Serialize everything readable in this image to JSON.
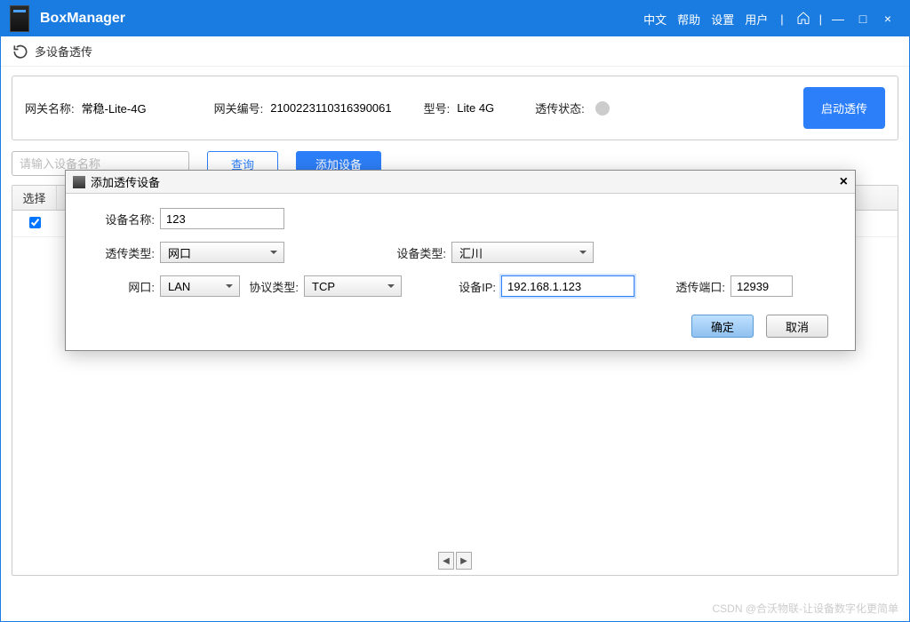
{
  "app": {
    "title": "BoxManager"
  },
  "titlebar": {
    "links": {
      "lang": "中文",
      "help": "帮助",
      "settings": "设置",
      "user": "用户"
    }
  },
  "subheader": {
    "title": "多设备透传"
  },
  "info": {
    "gw_name_lbl": "网关名称:",
    "gw_name_val": "常稳-Lite-4G",
    "gw_sn_lbl": "网关编号:",
    "gw_sn_val": "2100223110316390061",
    "model_lbl": "型号:",
    "model_val": "Lite 4G",
    "status_lbl": "透传状态:",
    "start_btn": "启动透传"
  },
  "toolbar": {
    "search_ph": "请输入设备名称",
    "query": "查询",
    "add": "添加设备"
  },
  "table": {
    "col_select": "选择",
    "row0_checked": true
  },
  "modal": {
    "title": "添加透传设备",
    "dev_name_lbl": "设备名称:",
    "dev_name_val": "123",
    "trans_type_lbl": "透传类型:",
    "trans_type_val": "网口",
    "dev_type_lbl": "设备类型:",
    "dev_type_val": "汇川",
    "net_lbl": "网口:",
    "net_val": "LAN",
    "proto_lbl": "协议类型:",
    "proto_val": "TCP",
    "ip_lbl": "设备IP:",
    "ip_val": "192.168.1.123",
    "port_lbl": "透传端口:",
    "port_val": "12939",
    "ok": "确定",
    "cancel": "取消"
  },
  "watermark": "CSDN @合沃物联-让设备数字化更简单"
}
